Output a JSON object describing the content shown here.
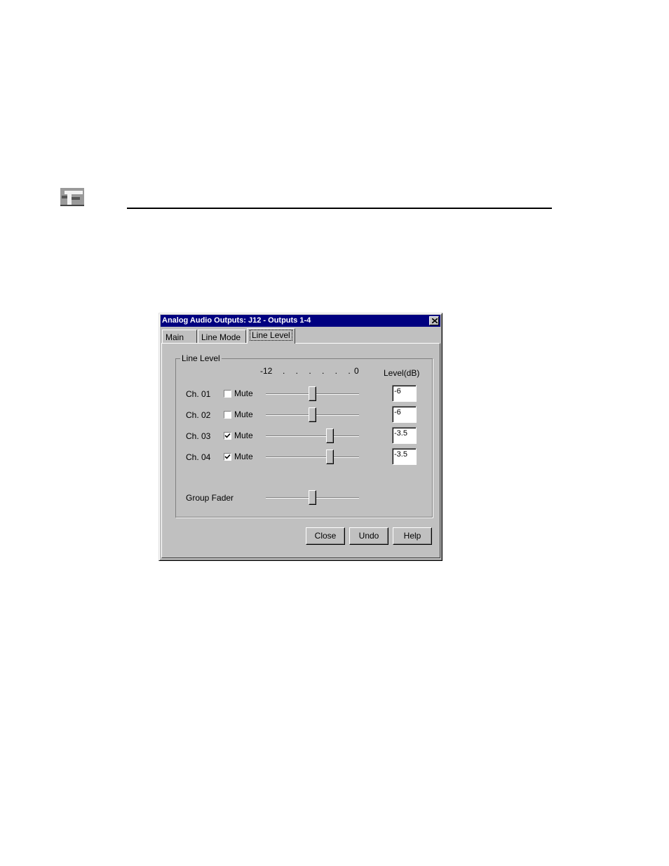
{
  "dialog": {
    "title": "Analog Audio Outputs: J12 - Outputs 1-4",
    "tabs": [
      {
        "label": "Main"
      },
      {
        "label": "Line Mode"
      },
      {
        "label": "Line Level",
        "active": true
      }
    ],
    "group_label": "Line Level",
    "scale": {
      "min_label": "-12",
      "max_label": "0",
      "dots": ". . . . . ."
    },
    "level_header": "Level(dB)",
    "mute_label": "Mute",
    "channels": [
      {
        "label": "Ch. 01",
        "muted": false,
        "level": "-6",
        "slider_value": -6
      },
      {
        "label": "Ch. 02",
        "muted": false,
        "level": "-6",
        "slider_value": -6
      },
      {
        "label": "Ch. 03",
        "muted": true,
        "level": "-3.5",
        "slider_value": -3.5
      },
      {
        "label": "Ch. 04",
        "muted": true,
        "level": "-3.5",
        "slider_value": -3.5
      }
    ],
    "group_fader": {
      "label": "Group Fader",
      "slider_value": -6
    },
    "buttons": {
      "close": "Close",
      "undo": "Undo",
      "help": "Help"
    }
  },
  "colors": {
    "titlebar": "#000080",
    "face": "#c0c0c0"
  }
}
